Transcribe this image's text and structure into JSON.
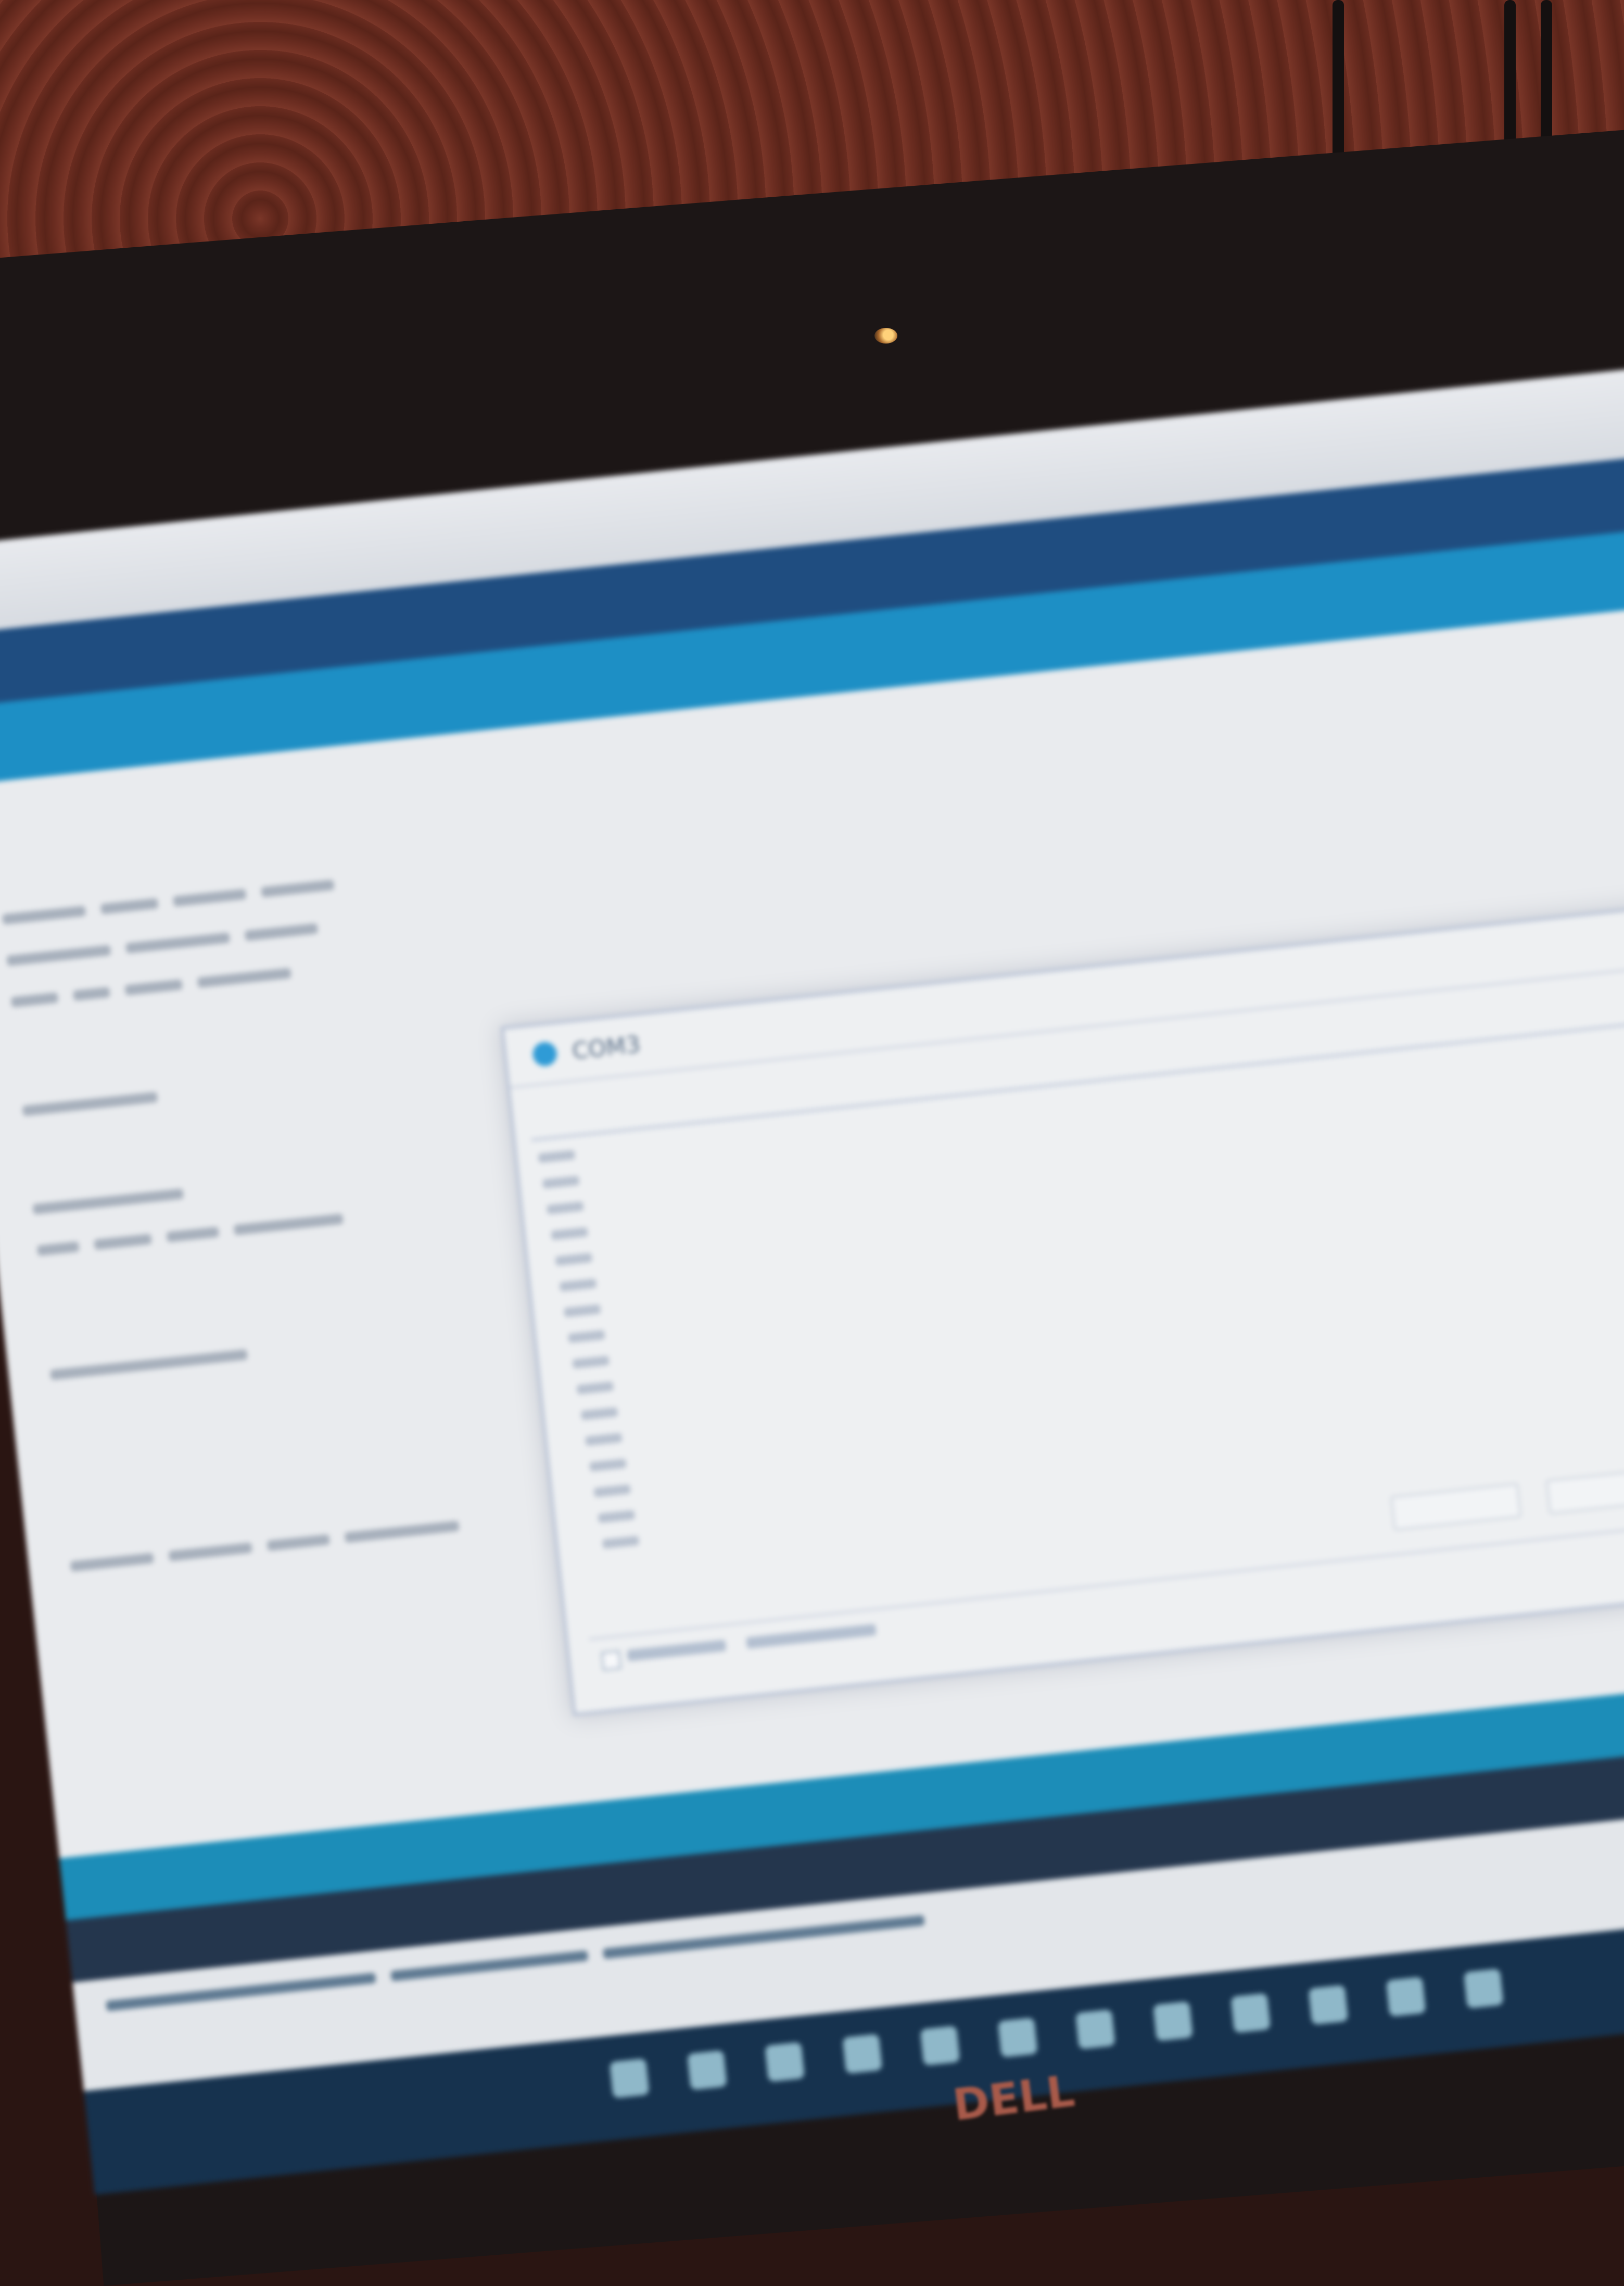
{
  "app": {
    "window_title": "COM3"
  },
  "serial_monitor": {
    "send_placeholder": "",
    "output_line_count": 16,
    "buttons": [
      "",
      ""
    ],
    "footer": {
      "autoscroll_checked": true
    }
  },
  "editor": {
    "visible_lines": 10
  },
  "taskbar": {
    "icon_count": 12
  },
  "colors": {
    "toolbar": "#1f4d80",
    "tabbar": "#1d8fc5",
    "status_teal": "#1c8db8",
    "status_dark": "#24364d",
    "monitor_accent": "#2f9bd6"
  },
  "brand": {
    "monitor_logo": "DELL"
  }
}
